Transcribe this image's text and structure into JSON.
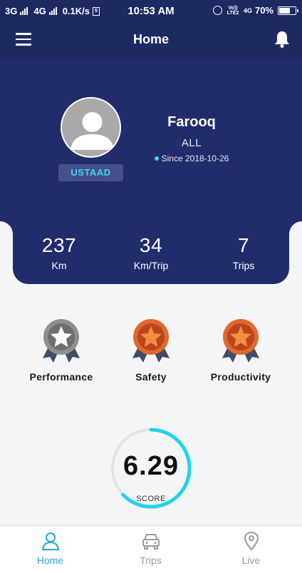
{
  "status_bar": {
    "network_1": "3G",
    "network_2": "4G",
    "speed": "0.1K/s",
    "time": "10:53 AM",
    "volte": "Vo)) LTE2",
    "network_3": "4G",
    "battery_percent": "70%",
    "battery_level": 0.7
  },
  "header": {
    "title": "Home"
  },
  "profile": {
    "name": "Farooq",
    "role": "ALL",
    "since": "Since 2018-10-26",
    "badge": "USTAAD"
  },
  "stats": [
    {
      "value": "237",
      "unit": "Km"
    },
    {
      "value": "34",
      "unit": "Km/Trip"
    },
    {
      "value": "7",
      "unit": "Trips"
    }
  ],
  "medals": [
    {
      "label": "Performance",
      "color": "#8f8f8f"
    },
    {
      "label": "Safety",
      "color": "#e2692b"
    },
    {
      "label": "Productivity",
      "color": "#e2692b"
    }
  ],
  "score": {
    "value": "6.29",
    "label": "SCORE",
    "fraction": 0.629
  },
  "bottom_nav": {
    "items": [
      {
        "label": "Home",
        "icon": "person-icon",
        "active": true
      },
      {
        "label": "Trips",
        "icon": "car-icon",
        "active": false
      },
      {
        "label": "Live",
        "icon": "location-pin-icon",
        "active": false
      }
    ]
  },
  "colors": {
    "primary": "#212c6b",
    "accent": "#3fd4f4",
    "nav_active": "#2fa3d6",
    "nav_inactive": "#9a9a9a"
  }
}
